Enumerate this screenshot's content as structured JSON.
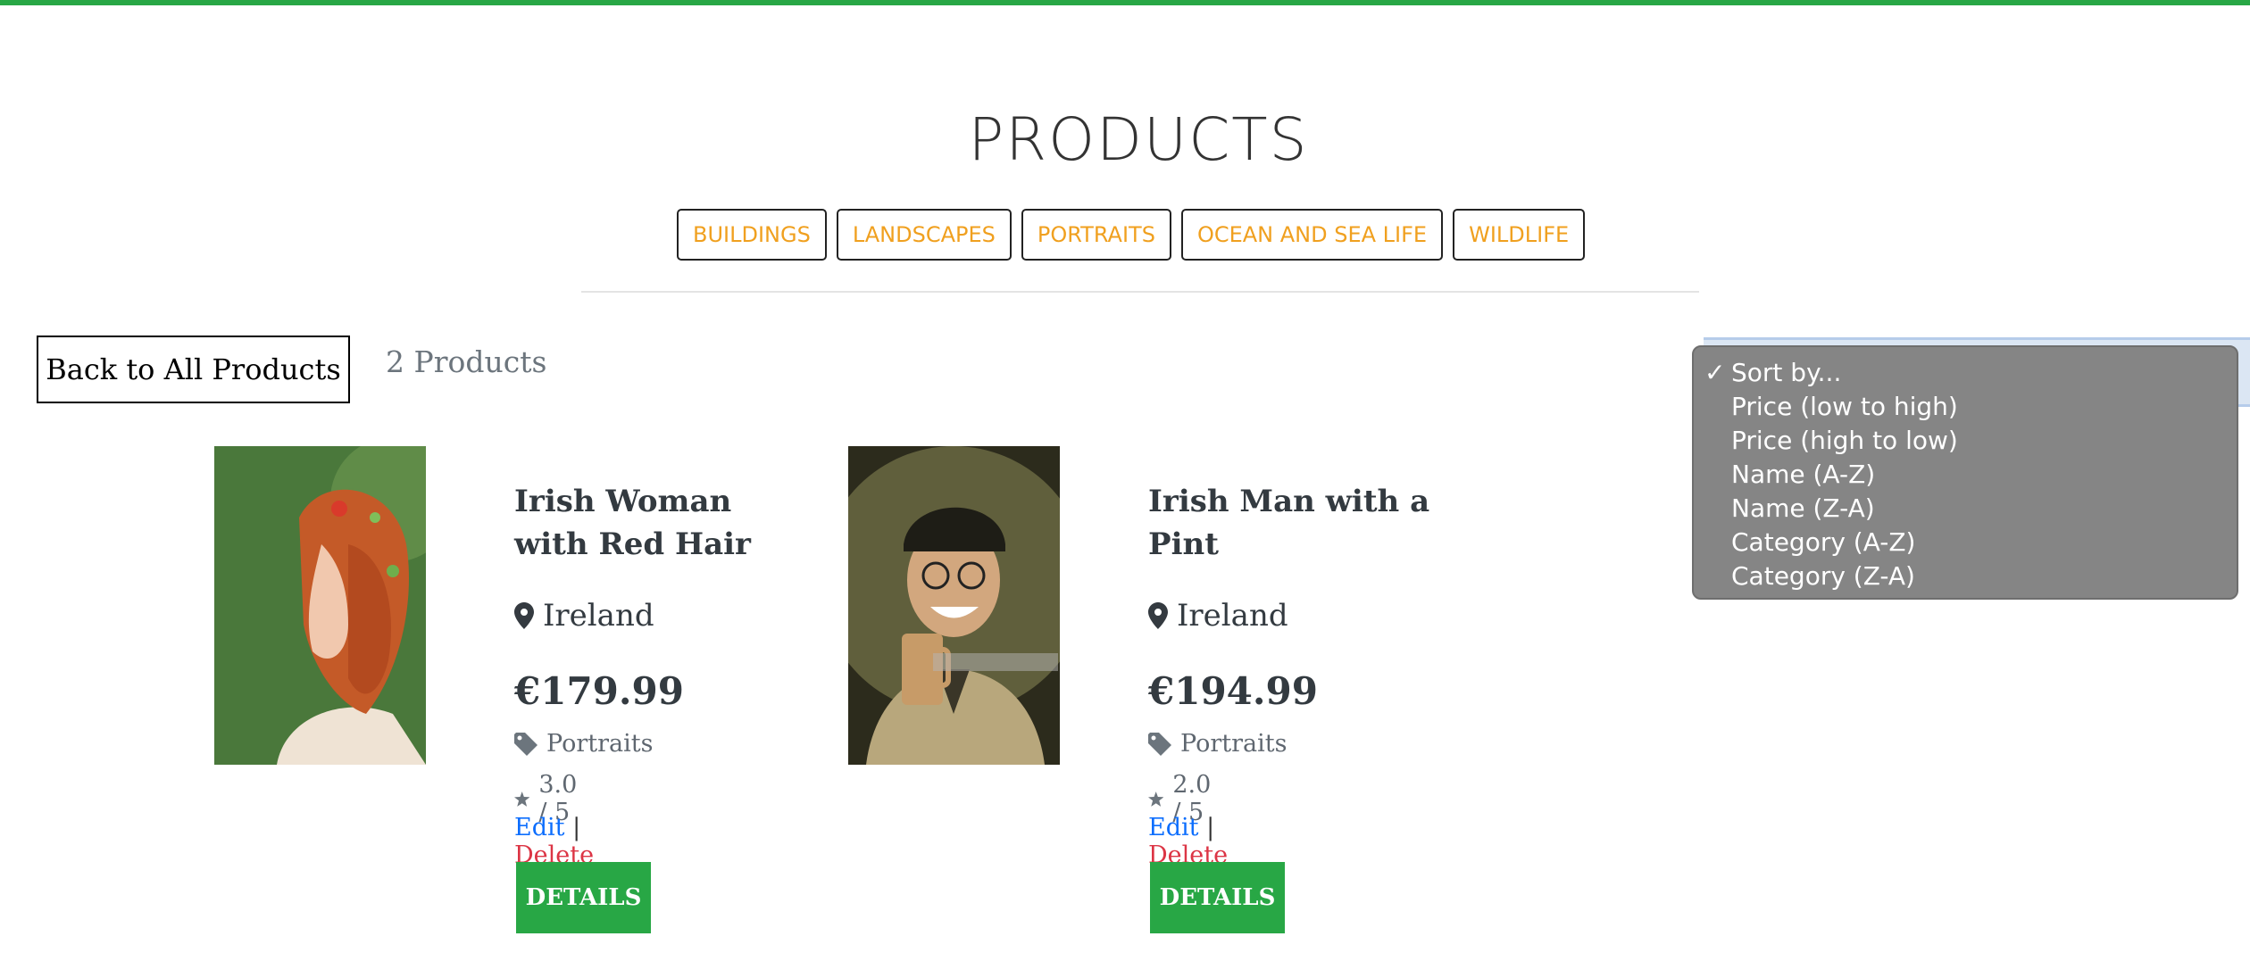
{
  "page": {
    "title": "PRODUCTS",
    "accent_color": "#28a745"
  },
  "categories": [
    "BUILDINGS",
    "LANDSCAPES",
    "PORTRAITS",
    "OCEAN AND SEA LIFE",
    "WILDLIFE"
  ],
  "toolbar": {
    "back_label": "Back to All Products",
    "count_label": "2 Products"
  },
  "sort": {
    "selected": "Sort by...",
    "check_mark": "✓",
    "options": [
      "Sort by...",
      "Price (low to high)",
      "Price (high to low)",
      "Name (A-Z)",
      "Name (Z-A)",
      "Category (A-Z)",
      "Category (Z-A)"
    ]
  },
  "products": [
    {
      "title": "Irish Woman with Red Hair",
      "location": "Ireland",
      "price": "€179.99",
      "category": "Portraits",
      "rating": "3.0 / 5",
      "edit_label": "Edit",
      "separator": "|",
      "delete_label": "Delete",
      "details_label": "DETAILS",
      "image_icon": "portrait-woman-red-hair"
    },
    {
      "title": "Irish Man with a Pint",
      "location": "Ireland",
      "price": "€194.99",
      "category": "Portraits",
      "rating": "2.0 / 5",
      "edit_label": "Edit",
      "separator": "|",
      "delete_label": "Delete",
      "details_label": "DETAILS",
      "image_icon": "portrait-man-with-pint"
    }
  ]
}
